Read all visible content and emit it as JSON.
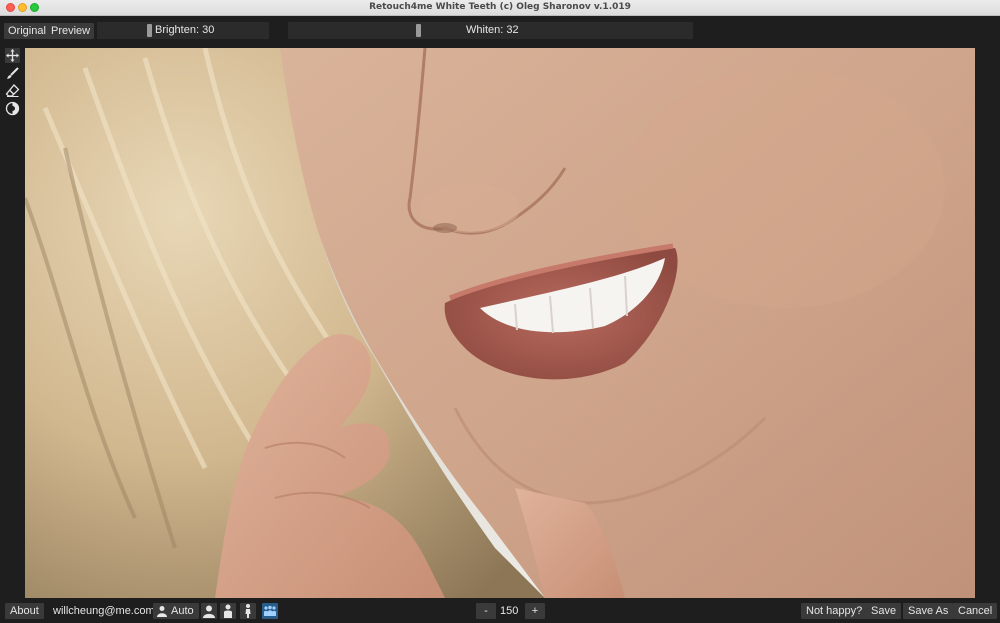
{
  "window": {
    "title": "Retouch4me White Teeth (c) Oleg Sharonov v.1.019"
  },
  "toolbar": {
    "original_label": "Original",
    "preview_label": "Preview",
    "brighten": {
      "label": "Brighten: 30",
      "value": 30
    },
    "whiten": {
      "label": "Whiten: 32",
      "value": 32
    }
  },
  "tools": [
    {
      "icon": "move-icon"
    },
    {
      "icon": "brush-icon"
    },
    {
      "icon": "eraser-icon"
    },
    {
      "icon": "mask-icon"
    }
  ],
  "bottom": {
    "about_label": "About",
    "email": "willcheung@me.com",
    "auto_label": "Auto",
    "zoom_minus": "-",
    "zoom_value": "150",
    "zoom_plus": "+",
    "not_happy_label": "Not happy?",
    "save_label": "Save",
    "save_as_label": "Save As",
    "cancel_label": "Cancel"
  }
}
